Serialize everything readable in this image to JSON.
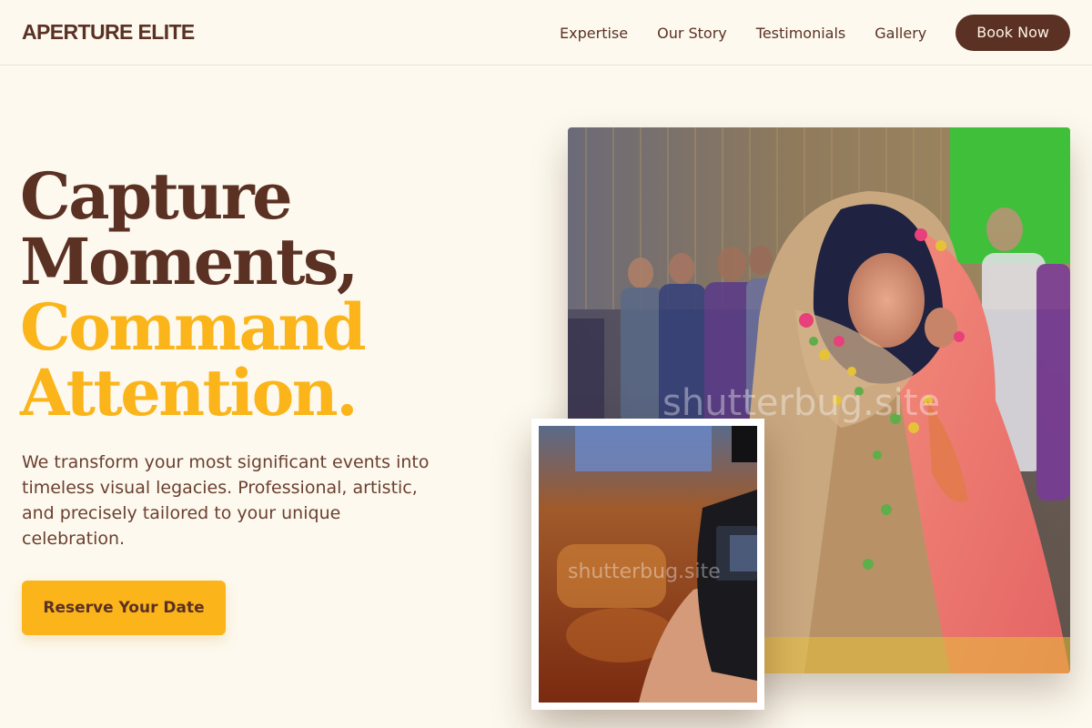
{
  "header": {
    "brand": "APERTURE ELITE",
    "nav": [
      "Expertise",
      "Our Story",
      "Testimonials",
      "Gallery"
    ],
    "cta": "Book Now"
  },
  "hero": {
    "title_line1": "Capture",
    "title_line2": "Moments,",
    "title_line3": "Command",
    "title_line4": "Attention.",
    "description": "We transform your most significant events into timeless visual legacies. Professional, artistic, and precisely tailored to your unique celebration.",
    "cta": "Reserve Your Date"
  },
  "images": {
    "main_watermark": "shutterbug.site",
    "secondary_watermark": "shutterbug.site"
  },
  "colors": {
    "background": "#fdf9ee",
    "brown": "#5b3124",
    "gold": "#fbb419"
  }
}
